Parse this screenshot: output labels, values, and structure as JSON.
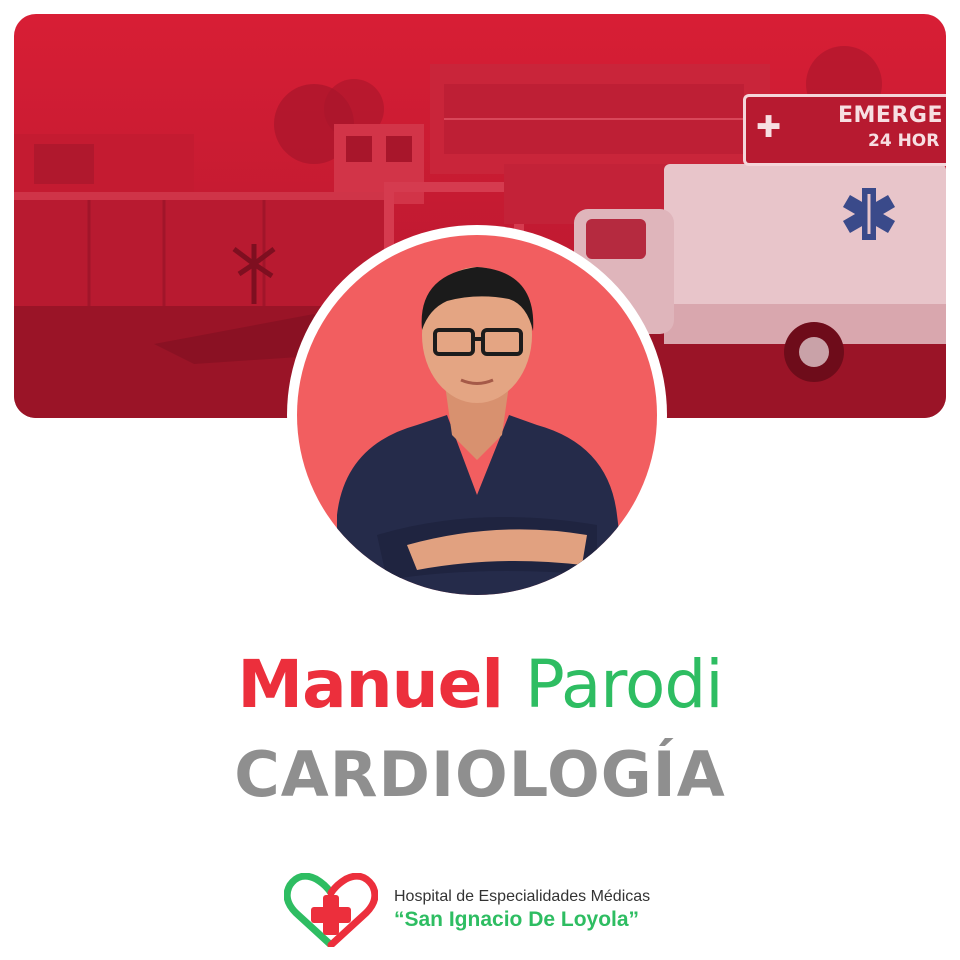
{
  "banner": {
    "sign_line1": "EMERGE",
    "sign_line2": "24 HOR",
    "sign_icon": "medical-cross-heartbeat"
  },
  "doctor": {
    "first_name": "Manuel",
    "last_name": "Parodi",
    "specialty": "CARDIOLOGÍA"
  },
  "hospital": {
    "line1": "Hospital de Especialidades Médicas",
    "line2": "“San Ignacio De Loyola”",
    "logo_icon": "heart-cross-logo"
  },
  "colors": {
    "brand_red": "#ec2f3c",
    "brand_green": "#2ebd62",
    "specialty_gray": "#8f8f8f",
    "banner_red": "#d81e35",
    "portrait_bg": "#f25e60"
  }
}
